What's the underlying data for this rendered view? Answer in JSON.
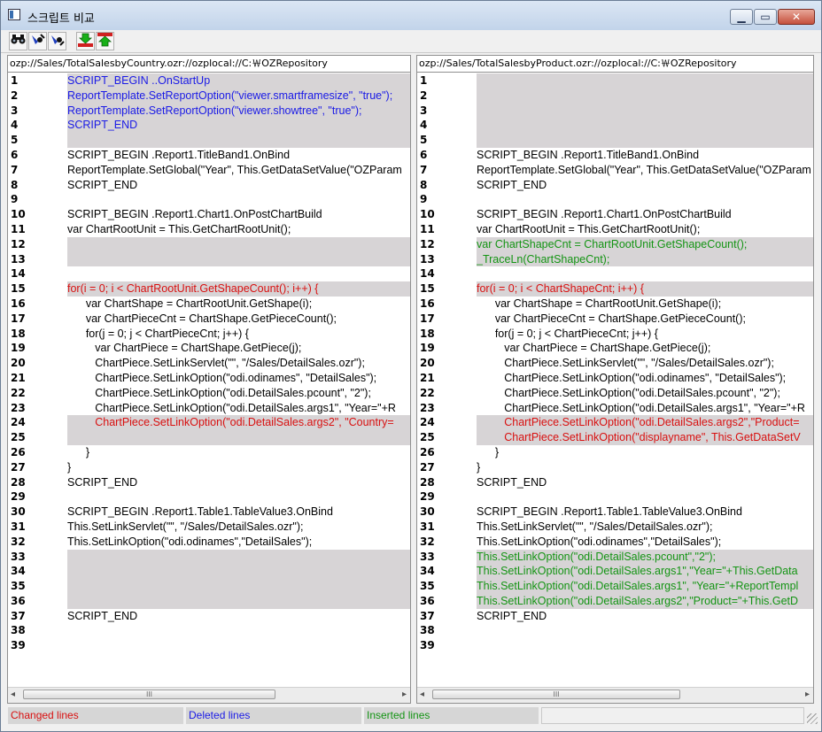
{
  "window": {
    "title": "스크립트 비교",
    "buttons": {
      "minimize": "▁",
      "maximize": "▭",
      "close": "✕"
    }
  },
  "toolbar": {
    "buttons": [
      {
        "name": "find-icon",
        "glyph": "⚲"
      },
      {
        "name": "find-prev-icon",
        "glyph": "◆"
      },
      {
        "name": "find-next-icon",
        "glyph": "◆"
      },
      {
        "name": "next-diff-icon",
        "glyph": "▼"
      },
      {
        "name": "prev-diff-icon",
        "glyph": "▲"
      }
    ]
  },
  "left": {
    "path": "ozp://Sales/TotalSalesbyCountry.ozr://ozplocal://C:￦OZRepository",
    "lines": [
      {
        "n": "1",
        "t": "SCRIPT_BEGIN ..OnStartUp",
        "s": "blue"
      },
      {
        "n": "2",
        "t": "ReportTemplate.SetReportOption(\"viewer.smartframesize\", \"true\");",
        "s": "blue"
      },
      {
        "n": "3",
        "t": "ReportTemplate.SetReportOption(\"viewer.showtree\", \"true\");",
        "s": "blue"
      },
      {
        "n": "4",
        "t": "SCRIPT_END",
        "s": "blue"
      },
      {
        "n": "5",
        "t": "",
        "s": "gray"
      },
      {
        "n": "6",
        "t": "SCRIPT_BEGIN .Report1.TitleBand1.OnBind",
        "s": ""
      },
      {
        "n": "7",
        "t": "ReportTemplate.SetGlobal(\"Year\", This.GetDataSetValue(\"OZParam",
        "s": ""
      },
      {
        "n": "8",
        "t": "SCRIPT_END",
        "s": ""
      },
      {
        "n": "9",
        "t": "",
        "s": ""
      },
      {
        "n": "10",
        "t": "SCRIPT_BEGIN .Report1.Chart1.OnPostChartBuild",
        "s": ""
      },
      {
        "n": "11",
        "t": "var ChartRootUnit = This.GetChartRootUnit();",
        "s": ""
      },
      {
        "n": "12",
        "t": "",
        "s": "gray"
      },
      {
        "n": "13",
        "t": "",
        "s": "gray"
      },
      {
        "n": "14",
        "t": "",
        "s": ""
      },
      {
        "n": "15",
        "t": "for(i = 0; i < ChartRootUnit.GetShapeCount(); i++) {",
        "s": "red"
      },
      {
        "n": "16",
        "t": "      var ChartShape = ChartRootUnit.GetShape(i);",
        "s": ""
      },
      {
        "n": "17",
        "t": "      var ChartPieceCnt = ChartShape.GetPieceCount();",
        "s": ""
      },
      {
        "n": "18",
        "t": "      for(j = 0; j < ChartPieceCnt; j++) {",
        "s": ""
      },
      {
        "n": "19",
        "t": "         var ChartPiece = ChartShape.GetPiece(j);",
        "s": ""
      },
      {
        "n": "20",
        "t": "         ChartPiece.SetLinkServlet(\"\", \"/Sales/DetailSales.ozr\");",
        "s": ""
      },
      {
        "n": "21",
        "t": "         ChartPiece.SetLinkOption(\"odi.odinames\", \"DetailSales\");",
        "s": ""
      },
      {
        "n": "22",
        "t": "         ChartPiece.SetLinkOption(\"odi.DetailSales.pcount\", \"2\");",
        "s": ""
      },
      {
        "n": "23",
        "t": "         ChartPiece.SetLinkOption(\"odi.DetailSales.args1\", \"Year=\"+R",
        "s": ""
      },
      {
        "n": "24",
        "t": "         ChartPiece.SetLinkOption(\"odi.DetailSales.args2\", \"Country=",
        "s": "red"
      },
      {
        "n": "25",
        "t": "",
        "s": "gray"
      },
      {
        "n": "26",
        "t": "      }",
        "s": ""
      },
      {
        "n": "27",
        "t": "}",
        "s": ""
      },
      {
        "n": "28",
        "t": "SCRIPT_END",
        "s": ""
      },
      {
        "n": "29",
        "t": "",
        "s": ""
      },
      {
        "n": "30",
        "t": "SCRIPT_BEGIN .Report1.Table1.TableValue3.OnBind",
        "s": ""
      },
      {
        "n": "31",
        "t": "This.SetLinkServlet(\"\", \"/Sales/DetailSales.ozr\");",
        "s": ""
      },
      {
        "n": "32",
        "t": "This.SetLinkOption(\"odi.odinames\",\"DetailSales\");",
        "s": ""
      },
      {
        "n": "33",
        "t": "",
        "s": "gray"
      },
      {
        "n": "34",
        "t": "",
        "s": "gray"
      },
      {
        "n": "35",
        "t": "",
        "s": "gray"
      },
      {
        "n": "36",
        "t": "",
        "s": "gray"
      },
      {
        "n": "37",
        "t": "SCRIPT_END",
        "s": ""
      },
      {
        "n": "38",
        "t": "",
        "s": ""
      },
      {
        "n": "39",
        "t": "",
        "s": ""
      }
    ]
  },
  "right": {
    "path": "ozp://Sales/TotalSalesbyProduct.ozr://ozplocal://C:￦OZRepository",
    "lines": [
      {
        "n": "1",
        "t": "",
        "s": "gray"
      },
      {
        "n": "2",
        "t": "",
        "s": "gray"
      },
      {
        "n": "3",
        "t": "",
        "s": "gray"
      },
      {
        "n": "4",
        "t": "",
        "s": "gray"
      },
      {
        "n": "5",
        "t": "",
        "s": "gray"
      },
      {
        "n": "6",
        "t": "SCRIPT_BEGIN .Report1.TitleBand1.OnBind",
        "s": ""
      },
      {
        "n": "7",
        "t": "ReportTemplate.SetGlobal(\"Year\", This.GetDataSetValue(\"OZParam",
        "s": ""
      },
      {
        "n": "8",
        "t": "SCRIPT_END",
        "s": ""
      },
      {
        "n": "9",
        "t": "",
        "s": ""
      },
      {
        "n": "10",
        "t": "SCRIPT_BEGIN .Report1.Chart1.OnPostChartBuild",
        "s": ""
      },
      {
        "n": "11",
        "t": "var ChartRootUnit = This.GetChartRootUnit();",
        "s": ""
      },
      {
        "n": "12",
        "t": "var ChartShapeCnt = ChartRootUnit.GetShapeCount();",
        "s": "green"
      },
      {
        "n": "13",
        "t": "_TraceLn(ChartShapeCnt);",
        "s": "green"
      },
      {
        "n": "14",
        "t": "",
        "s": ""
      },
      {
        "n": "15",
        "t": "for(i = 0; i < ChartShapeCnt; i++) {",
        "s": "red"
      },
      {
        "n": "16",
        "t": "      var ChartShape = ChartRootUnit.GetShape(i);",
        "s": ""
      },
      {
        "n": "17",
        "t": "      var ChartPieceCnt = ChartShape.GetPieceCount();",
        "s": ""
      },
      {
        "n": "18",
        "t": "      for(j = 0; j < ChartPieceCnt; j++) {",
        "s": ""
      },
      {
        "n": "19",
        "t": "         var ChartPiece = ChartShape.GetPiece(j);",
        "s": ""
      },
      {
        "n": "20",
        "t": "         ChartPiece.SetLinkServlet(\"\", \"/Sales/DetailSales.ozr\");",
        "s": ""
      },
      {
        "n": "21",
        "t": "         ChartPiece.SetLinkOption(\"odi.odinames\", \"DetailSales\");",
        "s": ""
      },
      {
        "n": "22",
        "t": "         ChartPiece.SetLinkOption(\"odi.DetailSales.pcount\", \"2\");",
        "s": ""
      },
      {
        "n": "23",
        "t": "         ChartPiece.SetLinkOption(\"odi.DetailSales.args1\", \"Year=\"+R",
        "s": ""
      },
      {
        "n": "24",
        "t": "         ChartPiece.SetLinkOption(\"odi.DetailSales.args2\",\"Product=",
        "s": "red"
      },
      {
        "n": "25",
        "t": "         ChartPiece.SetLinkOption(\"displayname\", This.GetDataSetV",
        "s": "red"
      },
      {
        "n": "26",
        "t": "      }",
        "s": ""
      },
      {
        "n": "27",
        "t": "}",
        "s": ""
      },
      {
        "n": "28",
        "t": "SCRIPT_END",
        "s": ""
      },
      {
        "n": "29",
        "t": "",
        "s": ""
      },
      {
        "n": "30",
        "t": "SCRIPT_BEGIN .Report1.Table1.TableValue3.OnBind",
        "s": ""
      },
      {
        "n": "31",
        "t": "This.SetLinkServlet(\"\", \"/Sales/DetailSales.ozr\");",
        "s": ""
      },
      {
        "n": "32",
        "t": "This.SetLinkOption(\"odi.odinames\",\"DetailSales\");",
        "s": ""
      },
      {
        "n": "33",
        "t": "This.SetLinkOption(\"odi.DetailSales.pcount\",\"2\");",
        "s": "green"
      },
      {
        "n": "34",
        "t": "This.SetLinkOption(\"odi.DetailSales.args1\",\"Year=\"+This.GetData",
        "s": "green"
      },
      {
        "n": "35",
        "t": "This.SetLinkOption(\"odi.DetailSales.args1\", \"Year=\"+ReportTempl",
        "s": "green"
      },
      {
        "n": "36",
        "t": "This.SetLinkOption(\"odi.DetailSales.args2\",\"Product=\"+This.GetD",
        "s": "green"
      },
      {
        "n": "37",
        "t": "SCRIPT_END",
        "s": ""
      },
      {
        "n": "38",
        "t": "",
        "s": ""
      },
      {
        "n": "39",
        "t": "",
        "s": ""
      }
    ]
  },
  "scrollbar": {
    "left_arrow": "◂",
    "right_arrow": "▸",
    "grip": "III"
  },
  "status": {
    "changed": "Changed lines",
    "deleted": "Deleted lines",
    "inserted": "Inserted lines"
  },
  "colors": {
    "changed": "#d81010",
    "deleted": "#1a1ae6",
    "inserted": "#149414",
    "highlight_bg": "#d7d4d6"
  }
}
